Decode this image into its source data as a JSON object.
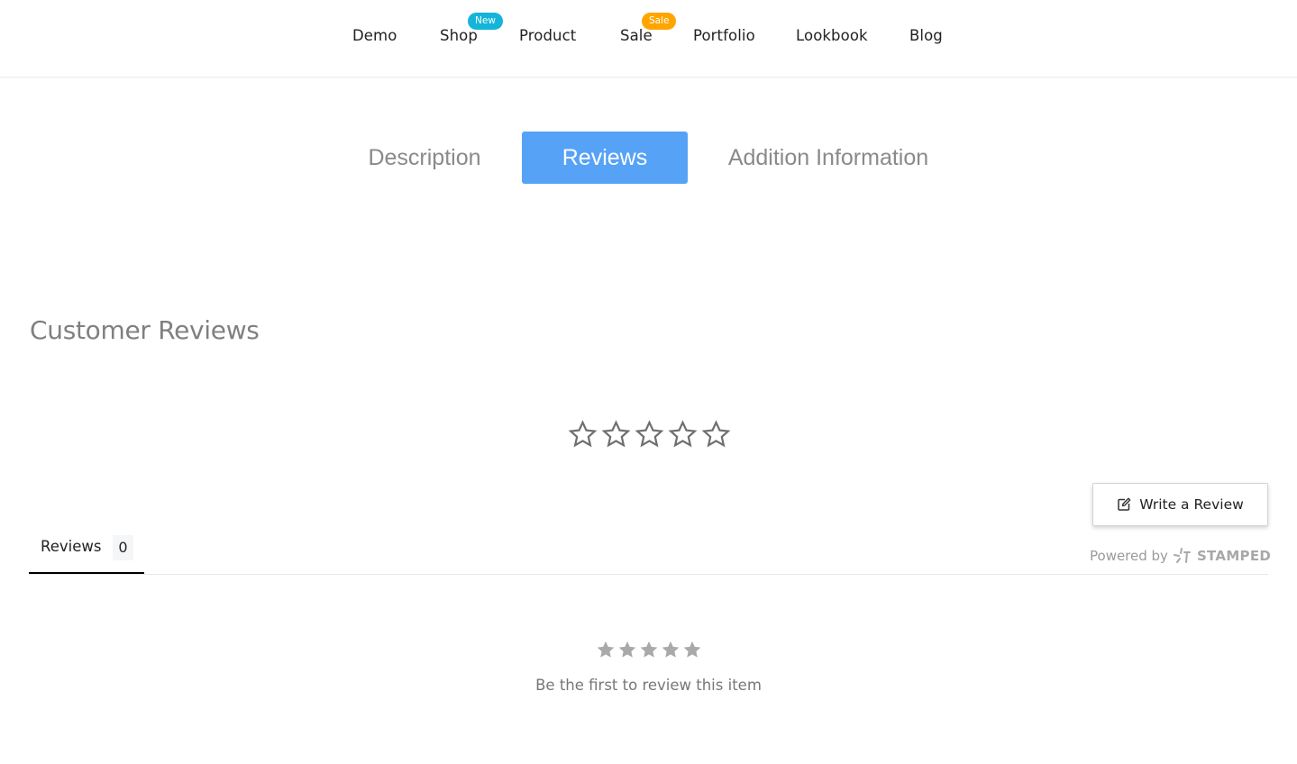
{
  "nav": {
    "items": [
      {
        "label": "Demo"
      },
      {
        "label": "Shop",
        "badge": "New"
      },
      {
        "label": "Product"
      },
      {
        "label": "Sale",
        "badge": "Sale"
      },
      {
        "label": "Portfolio"
      },
      {
        "label": "Lookbook"
      },
      {
        "label": "Blog"
      }
    ],
    "badge_colors": {
      "New": "#14b5d9",
      "Sale": "#ffa500"
    }
  },
  "product_tabs": {
    "items": [
      {
        "label": "Description",
        "active": false
      },
      {
        "label": "Reviews",
        "active": true
      },
      {
        "label": "Addition Information",
        "active": false
      }
    ],
    "active_color": "#56a2f7"
  },
  "reviews": {
    "title": "Customer Reviews",
    "average_rating": 0,
    "max_rating": 5,
    "write_button_label": "Write a Review",
    "powered_by_label": "Powered by",
    "powered_by_brand": "STAMPED",
    "tab_label": "Reviews",
    "tab_count": "0",
    "empty_message": "Be the first to review this item"
  }
}
